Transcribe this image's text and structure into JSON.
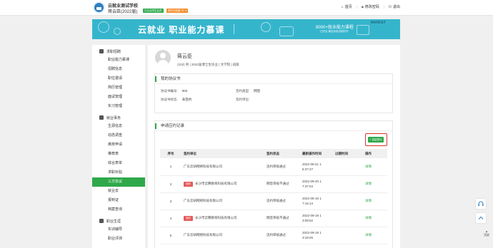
{
  "header": {
    "school": "云就业测试学校",
    "student": "蒋云臣(2022届)",
    "badge_green": "已认证学生会员",
    "badge_orange": "简历完成度 35 %",
    "nav": [
      {
        "icon": "home-icon",
        "label": "首页"
      },
      {
        "icon": "lock-icon",
        "label": "修改密码"
      },
      {
        "icon": "power-icon",
        "label": "退出"
      }
    ]
  },
  "banner": {
    "title": "云就业  职业能力慕课",
    "sub": "8000+就业能力课程",
    "sub2": "已完全  最佳系统自助的作",
    "market": "MARKET"
  },
  "sidebar": {
    "groups": [
      {
        "label": "求职招聘",
        "items": [
          "职业能力慕课",
          "招聘信息",
          "职位邀请",
          "简历管理",
          "面试管理",
          "实习管理"
        ]
      },
      {
        "label": "就业事务",
        "items": [
          "生源信息",
          "动态调查",
          "离校申请",
          "推荐表",
          "综合表单",
          "求职补贴",
          "三方协议",
          "就业去",
          "报到证",
          "档案查询"
        ]
      },
      {
        "label": "职业生涯",
        "items": [
          "实训辅导",
          "职业评测"
        ]
      }
    ],
    "active": "三方协议"
  },
  "profile": {
    "name": "蒋云臣",
    "info": "(102) 男 | 2022届博士生毕业 | 文学院 | 班级"
  },
  "agreement": {
    "title": "我的协议书",
    "fields": [
      {
        "label": "协议书编号:",
        "value": "002"
      },
      {
        "label": "签约类型:",
        "value": "网签"
      },
      {
        "label": "协议书状态:",
        "value": "未签约"
      },
      {
        "label": "签约单位:",
        "value": ""
      }
    ]
  },
  "applications": {
    "title": "申请应约记录",
    "add_button": "+ 发起签约",
    "columns": [
      "序号",
      "签约单位",
      "签约状态",
      "最新操作时间",
      "过期时间",
      "操作"
    ],
    "rows": [
      {
        "no": "1",
        "tag": "",
        "unit": "广东云研网络科技有限公司",
        "status": "违约审核通过",
        "time1": "2022-09-21 1",
        "time2": "6:37:27",
        "expire": "",
        "op": "详情"
      },
      {
        "no": "2",
        "tag": "违约",
        "unit": "长沙市云腾教育科技有限公司",
        "status": "网签审核不通过",
        "time1": "2022-09-20 1",
        "time2": "7:37:04",
        "expire": "",
        "op": "详情"
      },
      {
        "no": "3",
        "tag": "",
        "unit": "广东云研网络科技有限公司",
        "status": "违约审核通过",
        "time1": "2022-09-19 1",
        "time2": "7:15:14",
        "expire": "",
        "op": "详情"
      },
      {
        "no": "4",
        "tag": "违约",
        "unit": "长沙市云腾教育科技有限公司",
        "status": "网签审核不通过",
        "time1": "2022-09-19 1",
        "time2": "3:08:52",
        "expire": "",
        "op": "详情"
      },
      {
        "no": "5",
        "tag": "",
        "unit": "广东云研网络科技有限公司",
        "status": "违约审核通过",
        "time1": "2022-09-19 1",
        "time2": "3:18:26",
        "expire": "",
        "op": "详情"
      }
    ]
  },
  "fab": {
    "top_label": "顶部"
  },
  "colors": {
    "accent_green": "#2fa84a",
    "banner": "#35b5cc",
    "highlight_red": "#d9342b"
  }
}
